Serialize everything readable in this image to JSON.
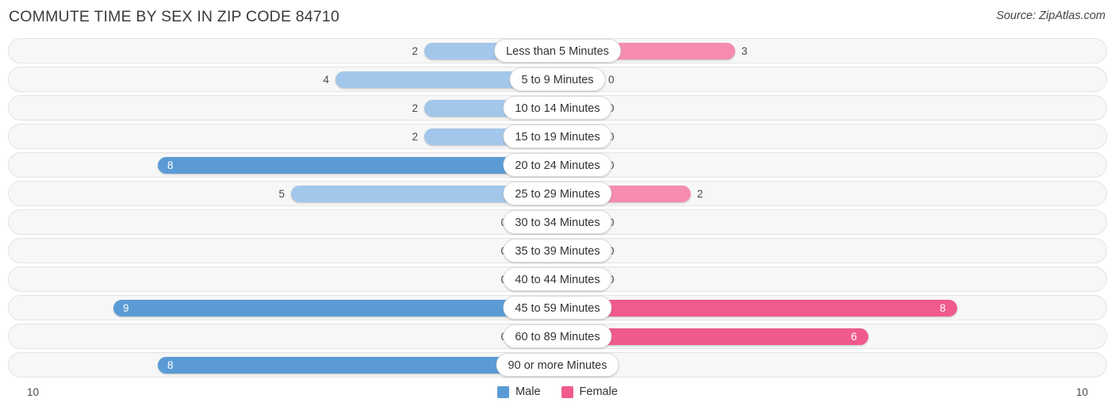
{
  "header": {
    "title": "COMMUTE TIME BY SEX IN ZIP CODE 84710",
    "source": "Source: ZipAtlas.com"
  },
  "legend": {
    "male_label": "Male",
    "female_label": "Female",
    "male_color": "#5B9BD5",
    "female_color": "#F05A8E"
  },
  "axis": {
    "left_label": "10",
    "right_label": "10",
    "max": 10
  },
  "colors": {
    "male_light": "#A3C7EA",
    "male_dark": "#5B9BD5",
    "female_light": "#F58CB0",
    "female_dark": "#F05A8E",
    "track_bg": "#F7F7F7",
    "track_border": "#E3E3E3"
  },
  "chart_data": {
    "type": "bar",
    "title": "COMMUTE TIME BY SEX IN ZIP CODE 84710",
    "subtitle": "Source: ZipAtlas.com",
    "orientation": "horizontal-diverging",
    "xlabel": "",
    "ylabel": "",
    "xlim": [
      10,
      10
    ],
    "grid": false,
    "legend_position": "bottom-center",
    "categories": [
      "Less than 5 Minutes",
      "5 to 9 Minutes",
      "10 to 14 Minutes",
      "15 to 19 Minutes",
      "20 to 24 Minutes",
      "25 to 29 Minutes",
      "30 to 34 Minutes",
      "35 to 39 Minutes",
      "40 to 44 Minutes",
      "45 to 59 Minutes",
      "60 to 89 Minutes",
      "90 or more Minutes"
    ],
    "series": [
      {
        "name": "Male",
        "values": [
          2,
          4,
          2,
          2,
          8,
          5,
          0,
          0,
          0,
          9,
          0,
          8
        ]
      },
      {
        "name": "Female",
        "values": [
          3,
          0,
          0,
          0,
          0,
          2,
          0,
          0,
          0,
          8,
          6,
          0
        ]
      }
    ]
  },
  "rows": [
    {
      "label": "Less than 5 Minutes",
      "male": "2",
      "female": "3"
    },
    {
      "label": "5 to 9 Minutes",
      "male": "4",
      "female": "0"
    },
    {
      "label": "10 to 14 Minutes",
      "male": "2",
      "female": "0"
    },
    {
      "label": "15 to 19 Minutes",
      "male": "2",
      "female": "0"
    },
    {
      "label": "20 to 24 Minutes",
      "male": "8",
      "female": "0"
    },
    {
      "label": "25 to 29 Minutes",
      "male": "5",
      "female": "2"
    },
    {
      "label": "30 to 34 Minutes",
      "male": "0",
      "female": "0"
    },
    {
      "label": "35 to 39 Minutes",
      "male": "0",
      "female": "0"
    },
    {
      "label": "40 to 44 Minutes",
      "male": "0",
      "female": "0"
    },
    {
      "label": "45 to 59 Minutes",
      "male": "9",
      "female": "8"
    },
    {
      "label": "60 to 89 Minutes",
      "male": "0",
      "female": "6"
    },
    {
      "label": "90 or more Minutes",
      "male": "8",
      "female": "0"
    }
  ]
}
